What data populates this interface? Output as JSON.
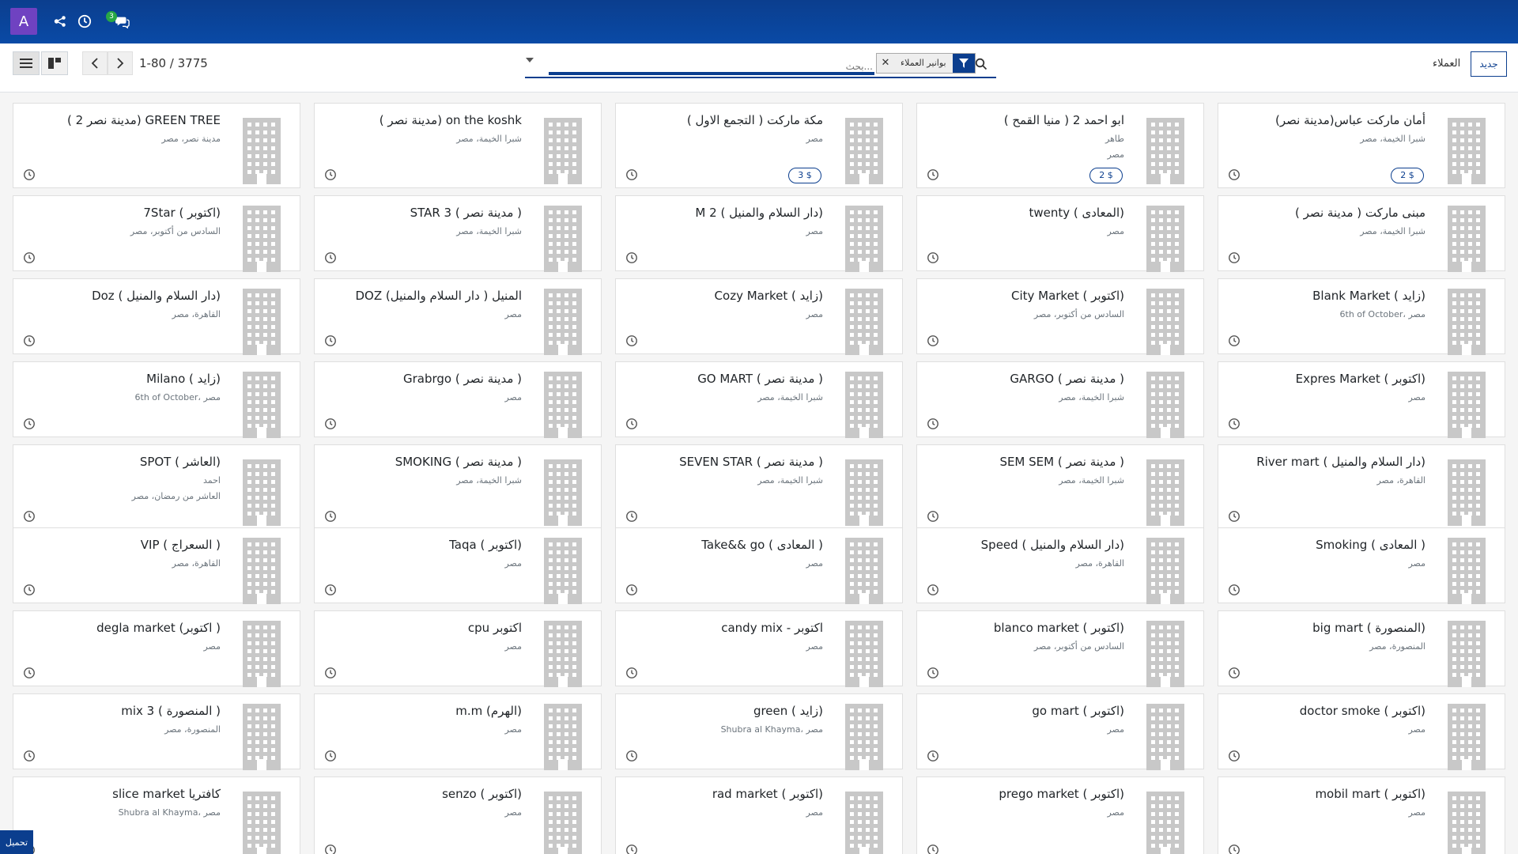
{
  "navbar": {
    "avatar_letter": "A",
    "icons": [
      "share-icon",
      "clock-icon",
      "chat-icon"
    ],
    "chat_badge": "3"
  },
  "control": {
    "breadcrumb": "العملاء",
    "new_button": "جديد",
    "pager_value": "1-80 / 3775",
    "search_placeholder": "بحث...",
    "facet_label": "بوانير العملاء"
  },
  "download_label": "تحميل",
  "cards": [
    {
      "title": "(أمان ماركت عباس(مدينة نصر",
      "lines": [
        "شبرا الخيمة، مصر"
      ],
      "tag": "2 $"
    },
    {
      "title": "ابو احمد 2 ( منيا القمح )",
      "lines": [
        "طاهر",
        "مصر"
      ],
      "tag": "2 $"
    },
    {
      "title": "مكة ماركت ( التجمع الاول )",
      "lines": [
        "مصر"
      ],
      "tag": "3 $"
    },
    {
      "title": "( مدينة نصر) on the koshk",
      "lines": [
        "شبرا الخيمة، مصر"
      ],
      "tag": ""
    },
    {
      "title": "( مدينة نصر 2) GREEN TREE",
      "lines": [
        "مدينة نصر، مصر"
      ],
      "tag": ""
    },
    {
      "title": "( مبنى ماركت ( مدينة نصر",
      "lines": [
        "شبرا الخيمة، مصر"
      ],
      "tag": ""
    },
    {
      "title": "twenty ( المعادى)",
      "lines": [
        "مصر"
      ],
      "tag": ""
    },
    {
      "title": "M 2 ( دار السلام والمنيل)",
      "lines": [
        "مصر"
      ],
      "tag": ""
    },
    {
      "title": "STAR 3 ( مدينة نصر )",
      "lines": [
        "شبرا الخيمة، مصر"
      ],
      "tag": ""
    },
    {
      "title": "7Star ( اكتوبر)",
      "lines": [
        "السادس من أكتوبر، مصر"
      ],
      "tag": ""
    },
    {
      "title": "Blank Market ( زايد)",
      "lines": [
        "6th of October، مصر"
      ],
      "tag": ""
    },
    {
      "title": "City Market ( اكتوبر)",
      "lines": [
        "السادس من أكتوبر، مصر"
      ],
      "tag": ""
    },
    {
      "title": "Cozy Market ( زايد)",
      "lines": [
        "مصر"
      ],
      "tag": ""
    },
    {
      "title": "DOZ المنيل ( دار السلام والمنيل)",
      "lines": [
        "مصر"
      ],
      "tag": ""
    },
    {
      "title": "Doz ( دار السلام والمنيل)",
      "lines": [
        "القاهرة، مصر"
      ],
      "tag": ""
    },
    {
      "title": "Expres Market ( اكتوبر)",
      "lines": [
        "مصر"
      ],
      "tag": ""
    },
    {
      "title": "GARGO ( مدينة نصر )",
      "lines": [
        "شبرا الخيمة، مصر"
      ],
      "tag": ""
    },
    {
      "title": "GO MART ( مدينة نصر )",
      "lines": [
        "شبرا الخيمة، مصر"
      ],
      "tag": ""
    },
    {
      "title": "Grabrgo ( مدينة نصر )",
      "lines": [
        "مصر"
      ],
      "tag": ""
    },
    {
      "title": "Milano ( زايد)",
      "lines": [
        "6th of October، مصر"
      ],
      "tag": ""
    },
    {
      "title": "River mart ( دار السلام والمنيل)",
      "lines": [
        "القاهرة، مصر"
      ],
      "tag": ""
    },
    {
      "title": "SEM SEM ( مدينة نصر )",
      "lines": [
        "شبرا الخيمة، مصر"
      ],
      "tag": ""
    },
    {
      "title": "SEVEN STAR ( مدينة نصر )",
      "lines": [
        "شبرا الخيمة، مصر"
      ],
      "tag": ""
    },
    {
      "title": "SMOKING ( مدينة نصر )",
      "lines": [
        "شبرا الخيمة، مصر"
      ],
      "tag": ""
    },
    {
      "title": "SPOT ( العاشر)",
      "lines": [
        "احمد",
        "العاشر من رمضان، مصر"
      ],
      "tag": ""
    },
    {
      "title": "Smoking ( المعادى )",
      "lines": [
        "مصر"
      ],
      "tag": ""
    },
    {
      "title": "Speed ( دار السلام والمنيل)",
      "lines": [
        "القاهرة، مصر"
      ],
      "tag": ""
    },
    {
      "title": "Take&& go ( المعادى )",
      "lines": [
        "مصر"
      ],
      "tag": ""
    },
    {
      "title": "Taqa ( اكتوبر)",
      "lines": [
        "مصر"
      ],
      "tag": ""
    },
    {
      "title": "VIP ( السعراج )",
      "lines": [
        "القاهرة، مصر"
      ],
      "tag": ""
    },
    {
      "title": "big mart ( المنصورة)",
      "lines": [
        "المنصورة، مصر"
      ],
      "tag": ""
    },
    {
      "title": "blanco market ( اكتوبر)",
      "lines": [
        "السادس من أكتوبر، مصر"
      ],
      "tag": ""
    },
    {
      "title": "candy mix - اكتوبر",
      "lines": [
        "مصر"
      ],
      "tag": ""
    },
    {
      "title": "cpu اكتوبر",
      "lines": [
        "مصر"
      ],
      "tag": ""
    },
    {
      "title": "degla market (اكتوبر )",
      "lines": [
        "مصر"
      ],
      "tag": ""
    },
    {
      "title": "doctor smoke ( اكتوبر)",
      "lines": [
        "مصر"
      ],
      "tag": ""
    },
    {
      "title": "go mart ( اكتوبر)",
      "lines": [
        "مصر"
      ],
      "tag": ""
    },
    {
      "title": "green ( زايد)",
      "lines": [
        "Shubra al Khayma، مصر"
      ],
      "tag": ""
    },
    {
      "title": "m.m (الهرم)",
      "lines": [
        "مصر"
      ],
      "tag": ""
    },
    {
      "title": "mix 3 ( المنصورة )",
      "lines": [
        "المنصورة، مصر"
      ],
      "tag": ""
    },
    {
      "title": "mobil mart ( اكتوبر)",
      "lines": [
        "مصر"
      ],
      "tag": ""
    },
    {
      "title": "prego market ( اكتوبر)",
      "lines": [
        "مصر"
      ],
      "tag": ""
    },
    {
      "title": "rad market ( اكتوبر)",
      "lines": [
        "مصر"
      ],
      "tag": ""
    },
    {
      "title": "senzo ( اكتوبر)",
      "lines": [
        "مصر"
      ],
      "tag": ""
    },
    {
      "title": "slice market كافتريا",
      "lines": [
        "Shubra al Khayma، مصر"
      ],
      "tag": ""
    }
  ]
}
